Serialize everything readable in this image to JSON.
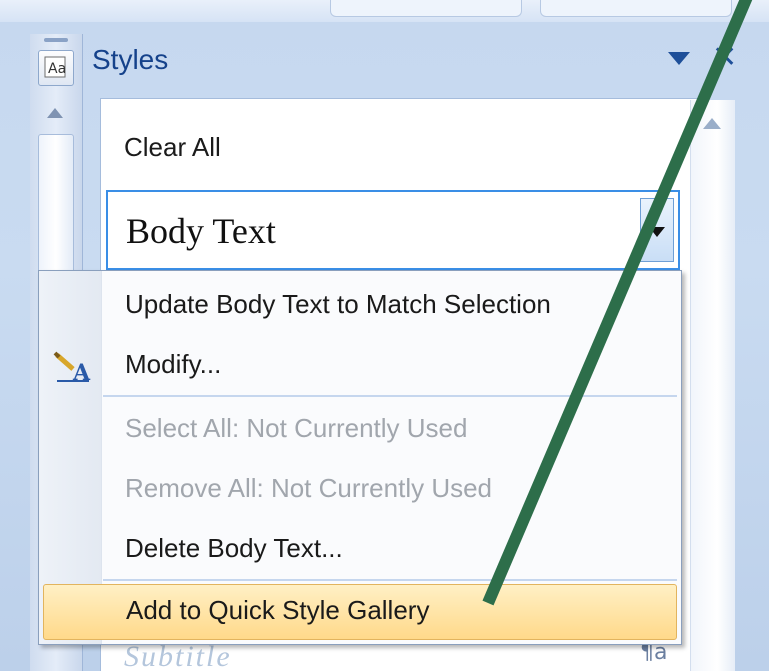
{
  "pane": {
    "title": "Styles",
    "close_glyph": "✕"
  },
  "styles_list": {
    "clear_all": "Clear All",
    "selected_style": "Body Text",
    "next_style_peek": "Subtitle",
    "next_style_mark": "¶a"
  },
  "context_menu": {
    "items": [
      {
        "label": "Update Body Text to Match Selection",
        "enabled": true
      },
      {
        "label": "Modify...",
        "enabled": true,
        "icon": "modify-style-icon"
      },
      {
        "label": "Select All: Not Currently Used",
        "enabled": false
      },
      {
        "label": "Remove All: Not Currently Used",
        "enabled": false
      },
      {
        "label": "Delete Body Text...",
        "enabled": true
      },
      {
        "label": "Add to Quick Style Gallery",
        "enabled": true,
        "highlighted": true
      }
    ]
  },
  "annotation": {
    "color": "#2d6e4a"
  },
  "colors": {
    "title_blue": "#15428b",
    "highlight": "#ffd98a",
    "selection_border": "#3a8ee6"
  }
}
